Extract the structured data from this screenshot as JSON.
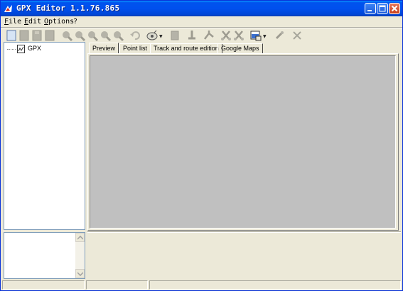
{
  "window": {
    "title": "GPX Editor 1.1.76.865",
    "minimize_icon": "minimize-icon",
    "maximize_icon": "maximize-icon",
    "close_icon": "close-icon"
  },
  "menu": {
    "items": [
      {
        "label": "File"
      },
      {
        "label": "Edit"
      },
      {
        "label": "Options"
      },
      {
        "label": "?"
      }
    ]
  },
  "toolbar": {
    "buttons": [
      {
        "icon": "new-file-icon",
        "enabled": true
      },
      {
        "icon": "open-file-icon",
        "enabled": false
      },
      {
        "icon": "save-icon",
        "enabled": false
      },
      {
        "icon": "save-as-icon",
        "enabled": false
      },
      {
        "icon": "zoom-in-icon",
        "enabled": false
      },
      {
        "icon": "zoom-out-icon",
        "enabled": false
      },
      {
        "icon": "zoom-fit-icon",
        "enabled": false
      },
      {
        "icon": "zoom-selection-icon",
        "enabled": false
      },
      {
        "icon": "zoom-previous-icon",
        "enabled": false
      },
      {
        "icon": "undo-icon",
        "enabled": false
      },
      {
        "icon": "gps-device-icon",
        "enabled": true,
        "dropdown": true
      },
      {
        "icon": "copy-icon",
        "enabled": false
      },
      {
        "icon": "split-icon",
        "enabled": false
      },
      {
        "icon": "merge-icon",
        "enabled": false
      },
      {
        "icon": "cut-track-icon",
        "enabled": false
      },
      {
        "icon": "cut-route-icon",
        "enabled": false
      },
      {
        "icon": "map-export-icon",
        "enabled": true,
        "dropdown": true
      },
      {
        "icon": "erase-icon",
        "enabled": false
      },
      {
        "icon": "delete-icon",
        "enabled": false
      }
    ]
  },
  "tree": {
    "root_label": "GPX",
    "root_icon": "gpx-document-icon"
  },
  "tabs": [
    {
      "label": "Preview",
      "active": true
    },
    {
      "label": "Point list",
      "active": false
    },
    {
      "label": "Track and route edition",
      "active": false
    },
    {
      "label": "Google Maps",
      "active": false
    }
  ],
  "colors": {
    "titlebar": "#0053ee",
    "preview_background": "#c0c0c0",
    "face": "#ece9d8"
  }
}
